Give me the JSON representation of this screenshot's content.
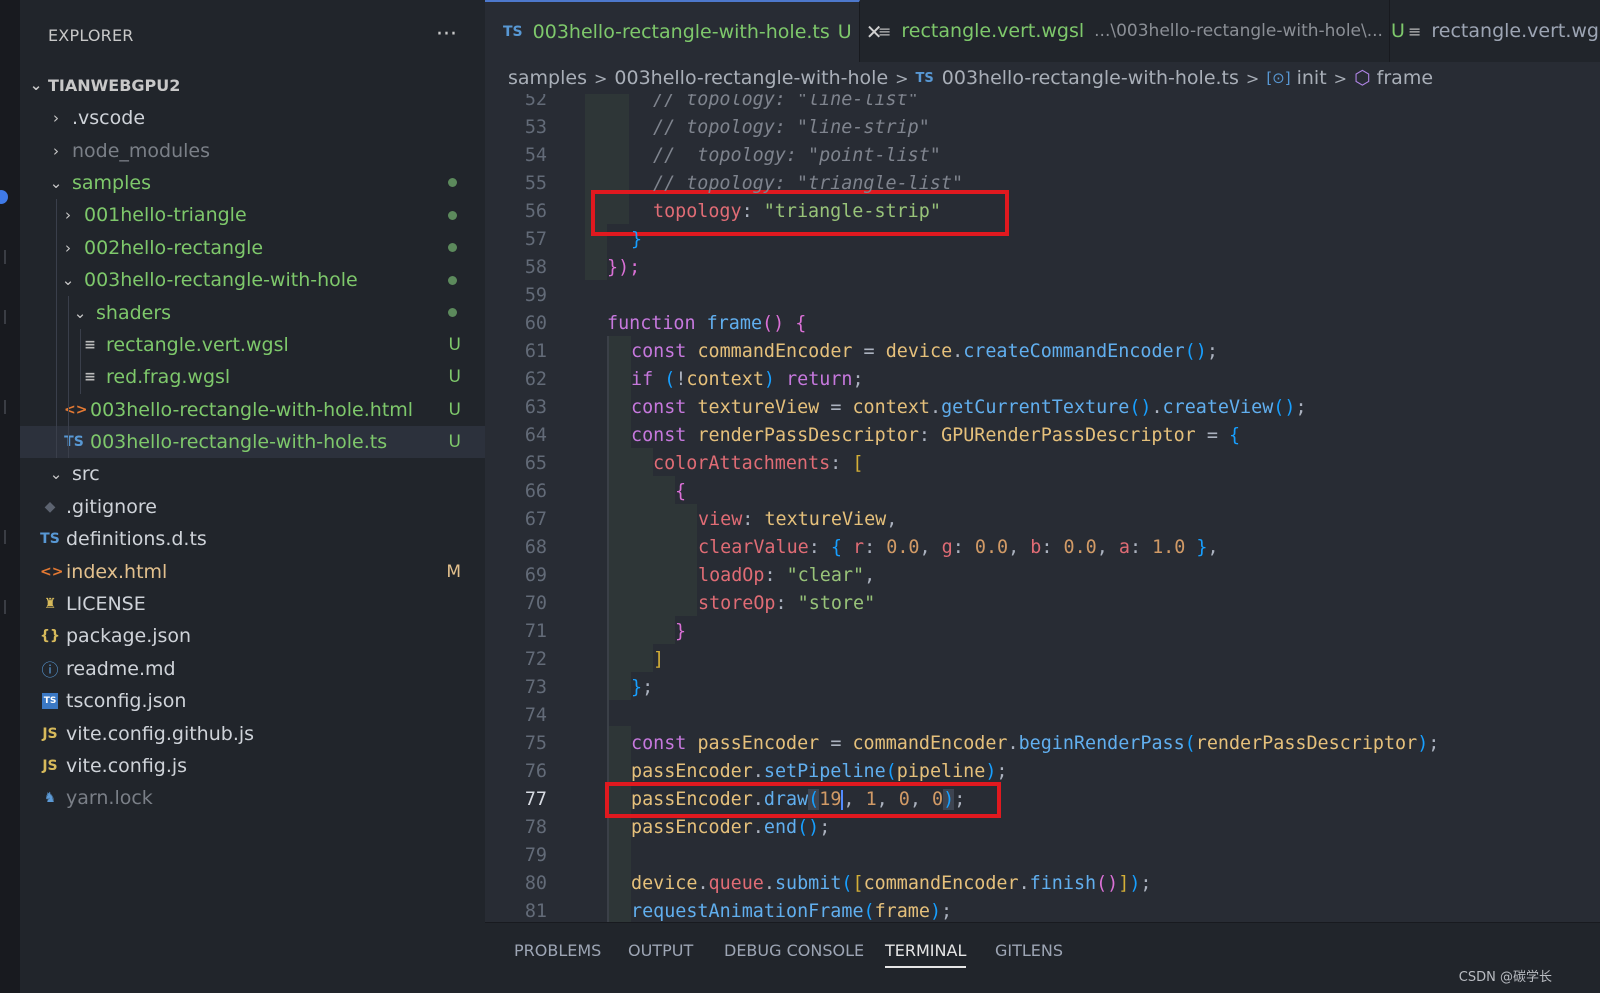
{
  "sidebar": {
    "title": "EXPLORER",
    "more_icon": "...",
    "root": "TIANWEBGPU2",
    "items": [
      {
        "label": ".vscode",
        "icon": "chevron-right",
        "status": ""
      },
      {
        "label": "node_modules",
        "icon": "chevron-right",
        "status": ""
      },
      {
        "label": "samples",
        "icon": "chevron-down",
        "status": "●"
      },
      {
        "label": "001hello-triangle",
        "icon": "chevron-right",
        "status": "●"
      },
      {
        "label": "002hello-rectangle",
        "icon": "chevron-right",
        "status": "●"
      },
      {
        "label": "003hello-rectangle-with-hole",
        "icon": "chevron-down",
        "status": "●"
      },
      {
        "label": "shaders",
        "icon": "chevron-down",
        "status": "●"
      },
      {
        "label": "rectangle.vert.wgsl",
        "icon": "lines-icon",
        "status": "U"
      },
      {
        "label": "red.frag.wgsl",
        "icon": "lines-icon",
        "status": "U"
      },
      {
        "label": "003hello-rectangle-with-hole.html",
        "icon": "html-icon",
        "status": "U"
      },
      {
        "label": "003hello-rectangle-with-hole.ts",
        "icon": "ts-icon",
        "status": "U"
      },
      {
        "label": "src",
        "icon": "chevron-down",
        "status": ""
      },
      {
        "label": ".gitignore",
        "icon": "git-icon",
        "status": ""
      },
      {
        "label": "definitions.d.ts",
        "icon": "ts-icon",
        "status": ""
      },
      {
        "label": "index.html",
        "icon": "html-icon",
        "status": "M"
      },
      {
        "label": "LICENSE",
        "icon": "license-icon",
        "status": ""
      },
      {
        "label": "package.json",
        "icon": "json-icon",
        "status": ""
      },
      {
        "label": "readme.md",
        "icon": "info-icon",
        "status": ""
      },
      {
        "label": "tsconfig.json",
        "icon": "tsconfig-icon",
        "status": ""
      },
      {
        "label": "vite.config.github.js",
        "icon": "js-icon",
        "status": ""
      },
      {
        "label": "vite.config.js",
        "icon": "js-icon",
        "status": ""
      },
      {
        "label": "yarn.lock",
        "icon": "yarn-icon",
        "status": ""
      }
    ],
    "icon_glyphs": {
      "ts": "TS",
      "js": "JS",
      "json": "{}",
      "html": "<>",
      "lines": "≡",
      "info": "ⓘ",
      "git": "◆",
      "license": "♜",
      "yarn": "♞"
    }
  },
  "tabs": [
    {
      "badge": "TS",
      "label": "003hello-rectangle-with-hole.ts",
      "status": "U",
      "close": "✕"
    },
    {
      "badge": "≡",
      "label": "rectangle.vert.wgsl",
      "path": "...\\003hello-rectangle-with-hole\\...",
      "status": "U"
    },
    {
      "badge": "≡",
      "label": "rectangle.vert.wgsl"
    }
  ],
  "breadcrumb": {
    "parts": [
      "samples",
      "003hello-rectangle-with-hole",
      "003hello-rectangle-with-hole.ts",
      "init",
      "frame"
    ],
    "sep": ">",
    "ts_badge": "TS",
    "init_symbol": "[⊙]",
    "frame_symbol": "⬡"
  },
  "editor": {
    "current_line": 77,
    "lines": [
      52,
      53,
      54,
      55,
      56,
      57,
      58,
      59,
      60,
      61,
      62,
      63,
      64,
      65,
      66,
      67,
      68,
      69,
      70,
      71,
      72,
      73,
      74,
      75,
      76,
      77,
      78,
      79,
      80,
      81
    ],
    "code": {
      "l52": "// topology: \"line-list\"",
      "l53": "// topology: \"line-strip\"",
      "l54": "//  topology: \"point-list\"",
      "l55": "// topology: \"triangle-list\"",
      "l56_key": "topology",
      "l56_val": "\"triangle-strip\"",
      "l57": "}",
      "l58": "});",
      "l60_kw": "function",
      "l60_fn": "frame",
      "l61_const": "const",
      "l61_var": "commandEncoder",
      "l61_obj": "device",
      "l61_fn": "createCommandEncoder",
      "l62_if": "if",
      "l62_var": "context",
      "l62_ret": "return",
      "l63_var": "textureView",
      "l63_obj": "context",
      "l63_fn1": "getCurrentTexture",
      "l63_fn2": "createView",
      "l64_var": "renderPassDescriptor",
      "l64_type": "GPURenderPassDescriptor",
      "l65_prop": "colorAttachments",
      "l67_prop": "view",
      "l67_val": "textureView",
      "l68_prop": "clearValue",
      "l68_r": "r",
      "l68_g": "g",
      "l68_b": "b",
      "l68_a": "a",
      "l68_rv": "0.0",
      "l68_gv": "0.0",
      "l68_bv": "0.0",
      "l68_av": "1.0",
      "l69_prop": "loadOp",
      "l69_val": "\"clear\"",
      "l70_prop": "storeOp",
      "l70_val": "\"store\"",
      "l75_var": "passEncoder",
      "l75_obj": "commandEncoder",
      "l75_fn": "beginRenderPass",
      "l75_arg": "renderPassDescriptor",
      "l76_obj": "passEncoder",
      "l76_fn": "setPipeline",
      "l76_arg": "pipeline",
      "l77_obj": "passEncoder",
      "l77_fn": "draw",
      "l77_a1": "19",
      "l77_a2": "1",
      "l77_a3": "0",
      "l77_a4": "0",
      "l78_obj": "passEncoder",
      "l78_fn": "end",
      "l80_obj": "device",
      "l80_prop": "queue",
      "l80_fn": "submit",
      "l80_arg": "commandEncoder",
      "l80_fn2": "finish",
      "l81_fn": "requestAnimationFrame",
      "l81_arg": "frame"
    }
  },
  "panel": {
    "tabs": [
      "PROBLEMS",
      "OUTPUT",
      "DEBUG CONSOLE",
      "TERMINAL",
      "GITLENS"
    ],
    "active": "TERMINAL"
  },
  "watermark": "CSDN @碳学长",
  "colors": {
    "accent": "#4d78cc",
    "highlight_box": "#e0191f",
    "git_added": "#7ec86b"
  }
}
